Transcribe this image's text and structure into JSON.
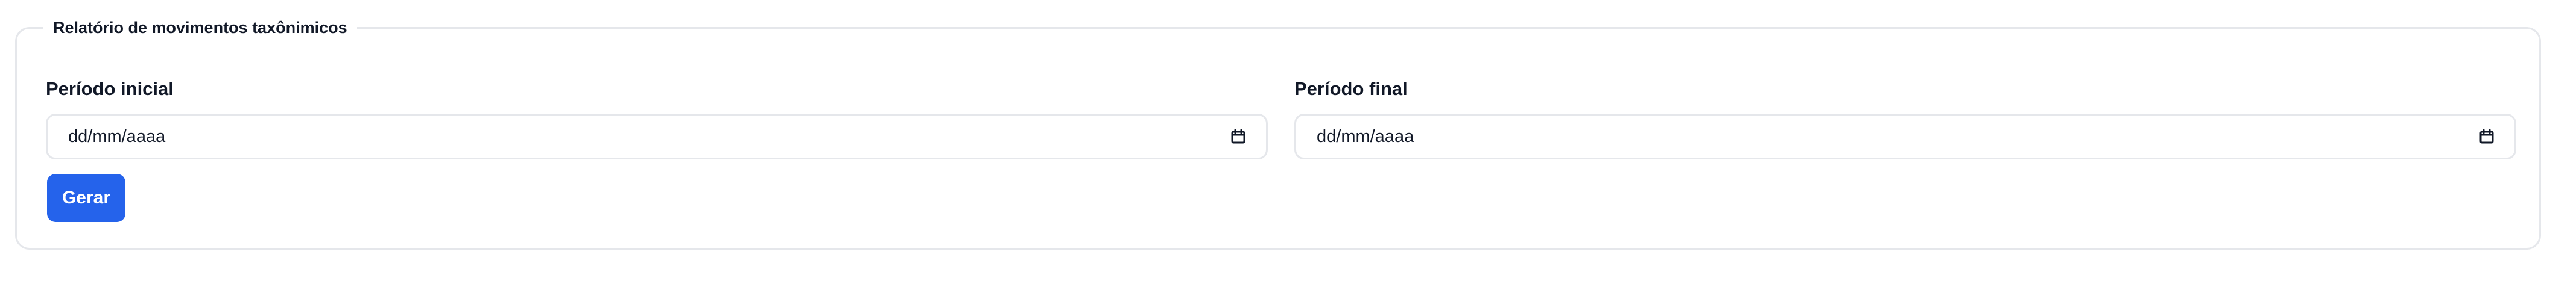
{
  "report": {
    "title": "Relatório de movimentos taxônimicos",
    "start_period": {
      "label": "Período inicial",
      "value": "dd/mm/aaaa",
      "icon": "calendar-icon"
    },
    "end_period": {
      "label": "Período final",
      "value": "dd/mm/aaaa",
      "icon": "calendar-icon"
    },
    "generate_button_label": "Gerar"
  },
  "colors": {
    "primary": "#2563eb",
    "border": "#e5e7eb",
    "text": "#111827",
    "background": "#ffffff"
  }
}
